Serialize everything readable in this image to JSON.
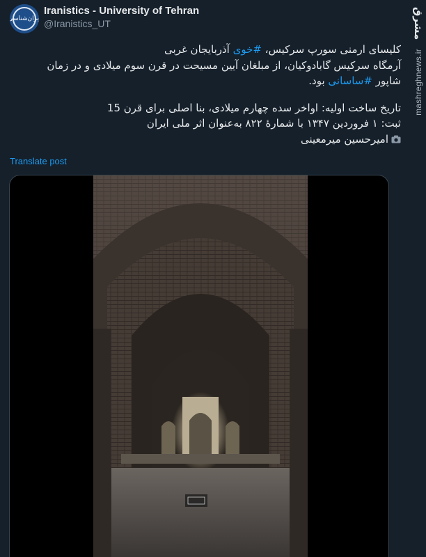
{
  "account": {
    "name": "Iranistics - University of Tehran",
    "handle": "@Iranistics_UT",
    "avatar_text": "ایران‌شناسی"
  },
  "tweet": {
    "line1_a": "کلیسای ارمنی سورپ سرکیس، ",
    "line1_hashtag": "#خوی",
    "line1_b": " آذربایجان غربی",
    "line2": "آرمگاه سرکیس گابادوکیان، از مبلغان آیین مسیحت در قرن سوم میلادی و در زمان",
    "line3_a": "شاپور ",
    "line3_hashtag": "#ساسانی",
    "line3_b": " بود.",
    "line4": "تاریخ ساخت اولیه: اواخر سده چهارم میلادی، بنا اصلی برای قرن 15",
    "line5": "ثبت: ۱ فروردین ۱۳۴۷ با شمارهٔ ۸۲۲ به‌عنوان اثر ملی ایران",
    "line6": "امیرحسین میرمعینی"
  },
  "translate_label": "Translate post",
  "watermark": {
    "logo": "مشرق",
    "url": "mashreghnews.ir"
  },
  "colors": {
    "background": "#15202b",
    "accent": "#1d9bf0",
    "text": "#e7e9ea",
    "secondary": "#8b98a5"
  }
}
